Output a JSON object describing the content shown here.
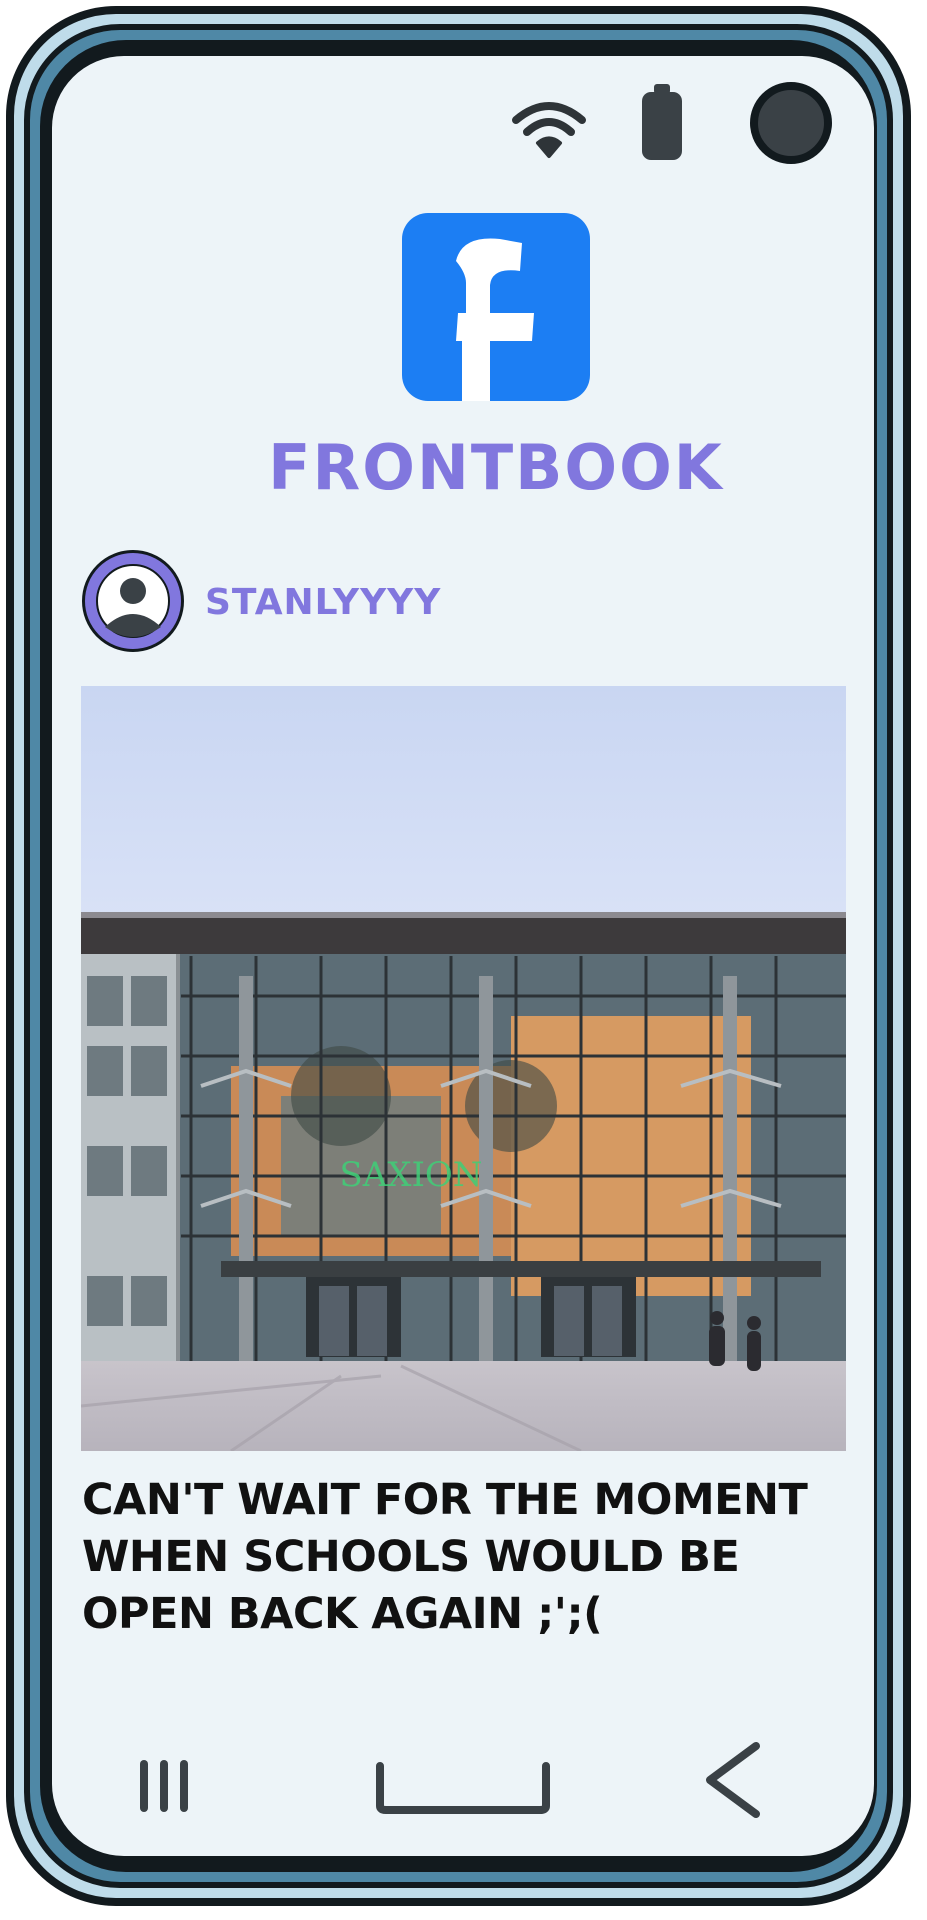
{
  "app": {
    "title": "Frontbook",
    "logo_icon": "frontbook-logo-icon",
    "brand_color": "#1c7ef3",
    "accent_color": "#8177de"
  },
  "status_bar": {
    "icons": [
      "wifi-icon",
      "battery-icon",
      "camera-icon"
    ]
  },
  "post": {
    "username": "Stanlyyyy",
    "avatar_icon": "user-silhouette-icon",
    "image_sign_text": "SAXION",
    "caption": "Can't wait for the moment when schools would be open back again       ;';("
  },
  "nav_bar": {
    "icons": [
      "recent-apps-icon",
      "home-icon",
      "back-icon"
    ]
  }
}
